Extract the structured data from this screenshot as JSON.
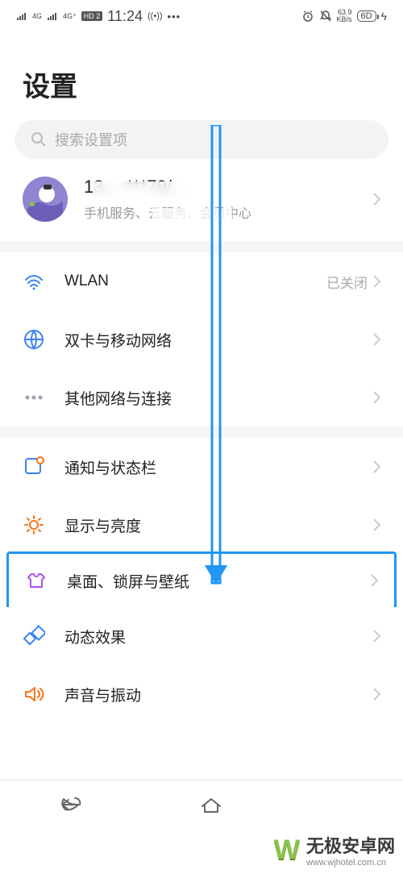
{
  "status": {
    "time": "11:24",
    "sig1": "4G",
    "sig2": "4G⁺",
    "hd": "HD 2",
    "net_speed": "63.9",
    "net_unit": "KB/s",
    "battery": "6D"
  },
  "page": {
    "title": "设置"
  },
  "search": {
    "placeholder": "搜索设置项"
  },
  "account": {
    "name": "13…:***70/…",
    "subtitle": "手机服务、云服务、会员中心"
  },
  "rows": {
    "wlan": {
      "label": "WLAN",
      "value": "已关闭"
    },
    "sim": {
      "label": "双卡与移动网络"
    },
    "other_net": {
      "label": "其他网络与连接"
    },
    "notif": {
      "label": "通知与状态栏"
    },
    "display": {
      "label": "显示与亮度"
    },
    "wallpaper": {
      "label": "桌面、锁屏与壁纸"
    },
    "motion": {
      "label": "动态效果"
    },
    "sound": {
      "label": "声音与振动"
    }
  },
  "watermark": {
    "brand_initial": "W",
    "brand": "无极安卓网",
    "url": "www.wjhotel.com.cn"
  }
}
